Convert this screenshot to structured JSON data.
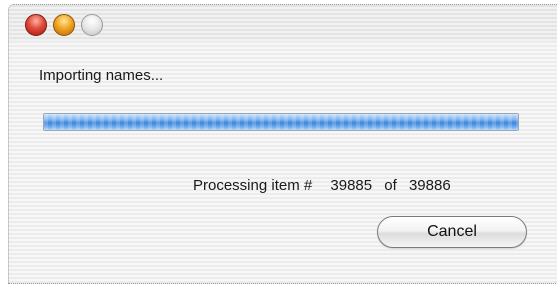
{
  "window": {
    "controls": [
      {
        "icon": "close-icon",
        "color": "#e14a3a"
      },
      {
        "icon": "minimize-icon",
        "color": "#f2a51e"
      },
      {
        "icon": "zoom-icon",
        "color": "#d9d9d9"
      }
    ]
  },
  "dialog": {
    "message": "Importing names...",
    "progress_fraction": 0.99997,
    "status_prefix": "Processing item #",
    "current_item": "39885",
    "of_label": "of",
    "total_items": "39886",
    "cancel_label": "Cancel"
  },
  "colors": {
    "progress_accent": "#3c86de"
  }
}
